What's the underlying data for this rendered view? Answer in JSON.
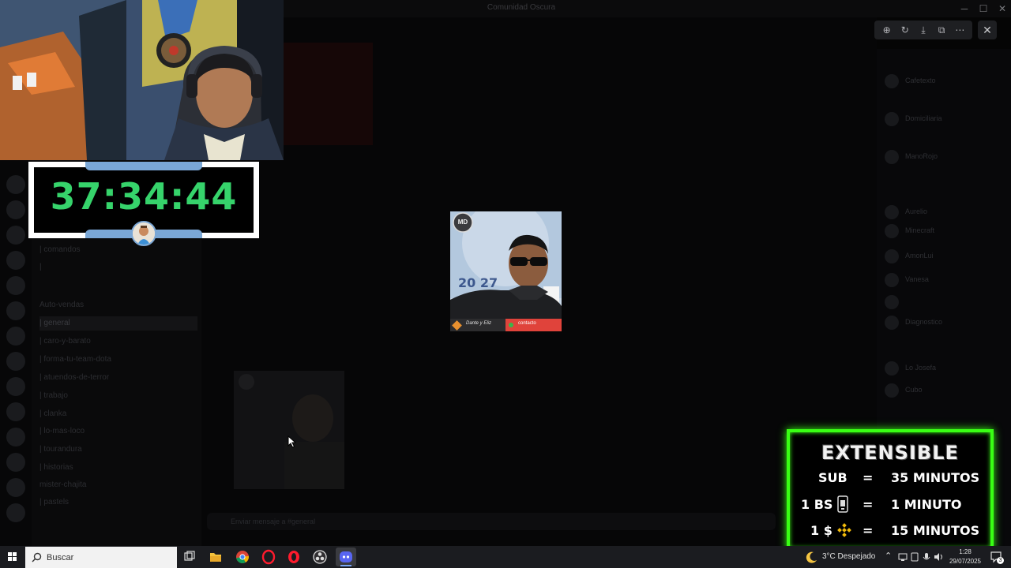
{
  "window": {
    "title": "Comunidad Oscura",
    "minimize": "─",
    "maximize": "☐",
    "close": "✕"
  },
  "channels": [
    "| comandos",
    "| ",
    "Auto-vendas",
    "| general",
    "| caro-y-barato",
    "| forma-tu-team-dota",
    "| atuendos-de-terror",
    "| trabajo",
    "| clanka",
    "| lo-mas-loco",
    "| tourandura",
    "| historias",
    "mister-chajita",
    "| pastels"
  ],
  "chat": {
    "input_placeholder": "Enviar mensaje a #general"
  },
  "members": [
    "Cafetexto",
    "Domiciliaria",
    "ManoRojo",
    "Aurelio",
    "Minecraft",
    "AmonLui",
    "Vanesa",
    "",
    "Diagnostico",
    "Lo Josefa",
    "Cubo"
  ],
  "viewer": {
    "tools": [
      "zoom-in",
      "rotate",
      "download",
      "open-external",
      "more"
    ],
    "tool_glyphs": [
      "⊕",
      "↻",
      "⤓",
      "⧉",
      "⋯"
    ],
    "close_glyph": "✕"
  },
  "focused_image": {
    "badge": "MD",
    "banner_left": "Dante  y  Eliz",
    "banner_right": "contacto"
  },
  "timer": {
    "value": "37:34:44",
    "accent": "#36d36b",
    "frame_color": "#7aa7d6"
  },
  "extensible": {
    "title": "EXTENSIBLE",
    "rows": [
      {
        "left": "SUB",
        "eq": "=",
        "right": "35 MINUTOS"
      },
      {
        "left": "1 BS",
        "eq": "=",
        "right": "1 MINUTO",
        "icon": "bs-card-icon"
      },
      {
        "left": "1 $",
        "eq": "=",
        "right": "15 MINUTOS",
        "icon": "binance-icon"
      }
    ],
    "border_color": "#39ff14"
  },
  "taskbar": {
    "search_placeholder": "Buscar",
    "apps": [
      "task-view",
      "file-explorer",
      "chrome",
      "opera",
      "opera-gx",
      "obs",
      "discord"
    ],
    "weather": "3°C  Despejado",
    "time": "1:28",
    "date": "29/07/2025",
    "notification_count": "3"
  }
}
